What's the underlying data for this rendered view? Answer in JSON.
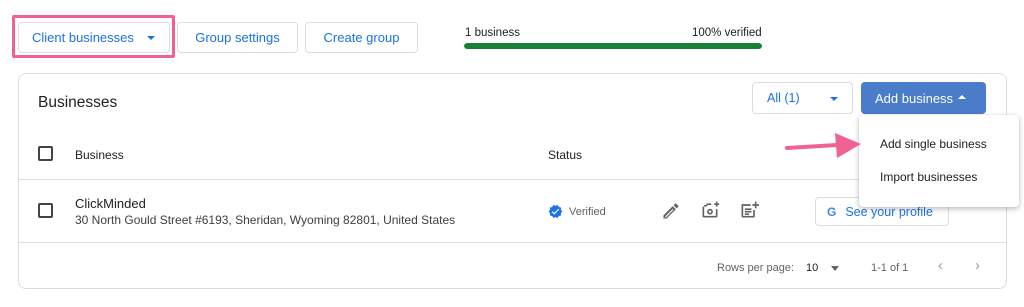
{
  "toolbar": {
    "client_businesses": "Client businesses",
    "group_settings": "Group settings",
    "create_group": "Create group"
  },
  "verification": {
    "count_label": "1 business",
    "percent_label": "100% verified",
    "progress_fraction": 1.0
  },
  "card": {
    "title": "Businesses",
    "filter_value": "All (1)",
    "add_business": "Add business"
  },
  "table": {
    "columns": [
      "Business",
      "Status"
    ],
    "rows": [
      {
        "name": "ClickMinded",
        "address": "30 North Gould Street #6193, Sheridan, Wyoming 82801, United States",
        "status": "Verified",
        "profile_button": "See your profile"
      }
    ]
  },
  "pagination": {
    "rows_per_page_label": "Rows per page:",
    "rows_per_page_value": "10",
    "range": "1-1 of 1"
  },
  "add_menu": {
    "items": [
      "Add single business",
      "Import businesses"
    ]
  },
  "colors": {
    "accent": "#1a73e8",
    "primary_button": "#4a7cc9",
    "progress": "#188038",
    "highlight": "#f06292"
  },
  "icons": [
    "caret-down-icon",
    "caret-up-icon",
    "verified-check-icon",
    "edit-pencil-icon",
    "add-photo-icon",
    "add-post-icon",
    "google-g-icon",
    "chevron-left-icon",
    "chevron-right-icon",
    "annotation-arrow-icon"
  ]
}
